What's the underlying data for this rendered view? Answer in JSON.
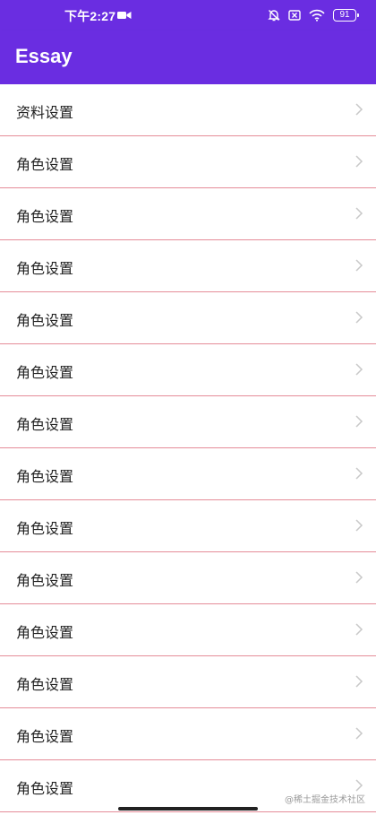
{
  "status_bar": {
    "time": "下午2:27",
    "battery": "91"
  },
  "app_bar": {
    "title": "Essay"
  },
  "list": {
    "items": [
      {
        "label": "资料设置"
      },
      {
        "label": "角色设置"
      },
      {
        "label": "角色设置"
      },
      {
        "label": "角色设置"
      },
      {
        "label": "角色设置"
      },
      {
        "label": "角色设置"
      },
      {
        "label": "角色设置"
      },
      {
        "label": "角色设置"
      },
      {
        "label": "角色设置"
      },
      {
        "label": "角色设置"
      },
      {
        "label": "角色设置"
      },
      {
        "label": "角色设置"
      },
      {
        "label": "角色设置"
      },
      {
        "label": "角色设置"
      }
    ]
  },
  "watermark": "@稀土掘金技术社区",
  "colors": {
    "primary": "#6a2de1",
    "divider": "#e58c98",
    "chevron": "#c8c8c8"
  },
  "icons": [
    "video-icon",
    "mute-bell-icon",
    "sim-x-icon",
    "wifi-icon",
    "battery-icon",
    "chevron-right-icon"
  ]
}
